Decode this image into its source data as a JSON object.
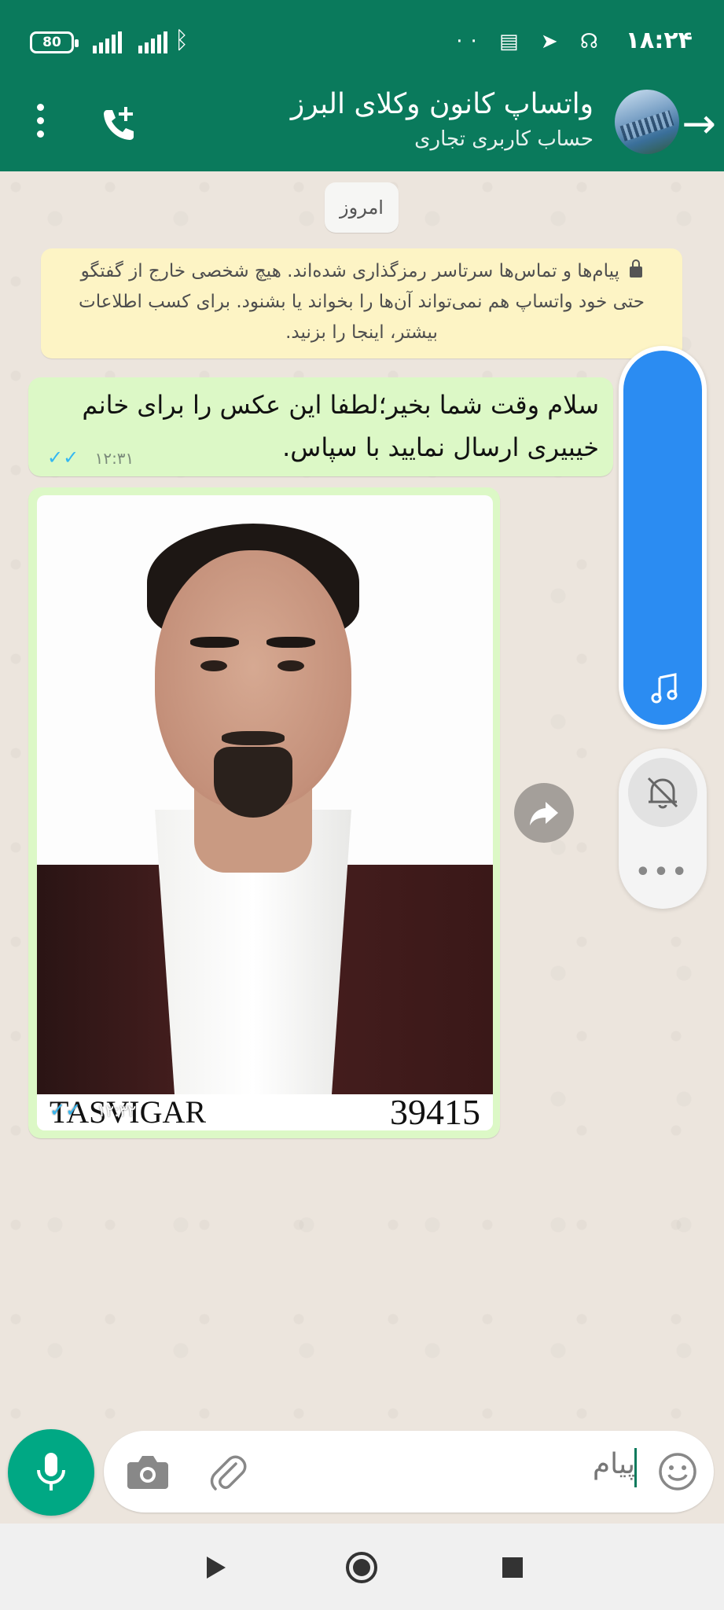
{
  "status_bar": {
    "time": "۱۸:۲۴",
    "battery": "80",
    "icons": [
      "battery-icon",
      "signal-icon",
      "signal-icon",
      "bluetooth-icon",
      "dots-icon",
      "sms-icon",
      "telegram-icon",
      "headset-icon"
    ]
  },
  "header": {
    "title": "واتساپ کانون وکلای البرز",
    "subtitle": "حساب کاربری تجاری",
    "back_icon": "arrow-right-icon",
    "add_call_icon": "add-call-icon",
    "menu_icon": "more-vert-icon"
  },
  "chat": {
    "date_chip": "امروز",
    "encryption_notice": "پیام‌ها و تماس‌ها سرتاسر رمزگذاری شده‌اند. هیچ شخصی خارج از گفتگو حتی خود واتساپ هم نمی‌تواند آن‌ها را بخواند یا بشنود. برای کسب اطلاعات بیشتر، اینجا را بزنید.",
    "messages": [
      {
        "type": "text",
        "text": "سلام وقت شما بخیر؛لطفا این عکس را برای خانم خیبیری ارسال نمایید با سپاس.",
        "time": "۱۲:۳۱",
        "status": "read"
      },
      {
        "type": "image",
        "image_caption_left": "TASVIGAR",
        "image_caption_right": "39415",
        "time": "۱۲:۳۲",
        "status": "read"
      }
    ]
  },
  "floating": {
    "music_icon": "music-note-icon",
    "mute_icon": "bell-off-icon",
    "more_label": "•••"
  },
  "composer": {
    "placeholder": "پیام",
    "emoji_icon": "emoji-icon",
    "attach_icon": "paperclip-icon",
    "camera_icon": "camera-icon",
    "mic_icon": "mic-icon"
  },
  "navbar": {
    "icons": [
      "play-icon",
      "home-circle-icon",
      "stop-square-icon"
    ]
  },
  "colors": {
    "header": "#0a7a5c",
    "outgoing_bubble": "#dcf8c6",
    "notice": "#fdf4c5",
    "accent_green": "#00a884",
    "read_ticks": "#34b7f1",
    "music_pill": "#2b8cf2"
  }
}
